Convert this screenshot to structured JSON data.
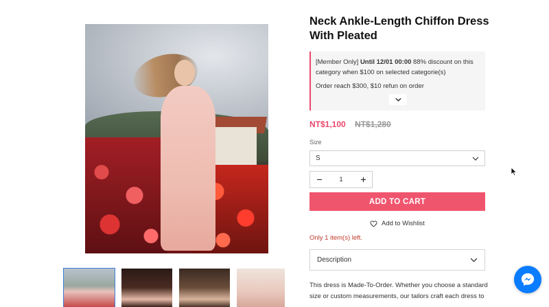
{
  "product": {
    "title": "Neck Ankle-Length Chiffon Dress With Pleated",
    "price_now": "NT$1,100",
    "price_was": "NT$1,280"
  },
  "promo": {
    "member_tag": "[Member Only]",
    "until": "Until 12/01 00:00",
    "discount_text": "88% discount on this category when $100 on selected categorie(s)",
    "refund_text": "Order reach $300, $10 refun on order"
  },
  "options": {
    "size_label": "Size",
    "size_value": "S",
    "quantity": "1"
  },
  "actions": {
    "add_to_cart": "ADD TO CART",
    "wishlist": "Add to Wishlist"
  },
  "stock_text": "Only 1 item(s) left.",
  "description": {
    "heading": "Description",
    "text": "This dress is Made-To-Order. Whether you choose a standard size or custom measurements, our tailors craft each dress to"
  },
  "colors": {
    "accent": "#f0556e",
    "price": "#e8476b",
    "messenger": "#0a7cff"
  },
  "icons": [
    "chevron-down-icon",
    "minus-icon",
    "plus-icon",
    "heart-icon",
    "messenger-icon",
    "cursor-icon"
  ]
}
